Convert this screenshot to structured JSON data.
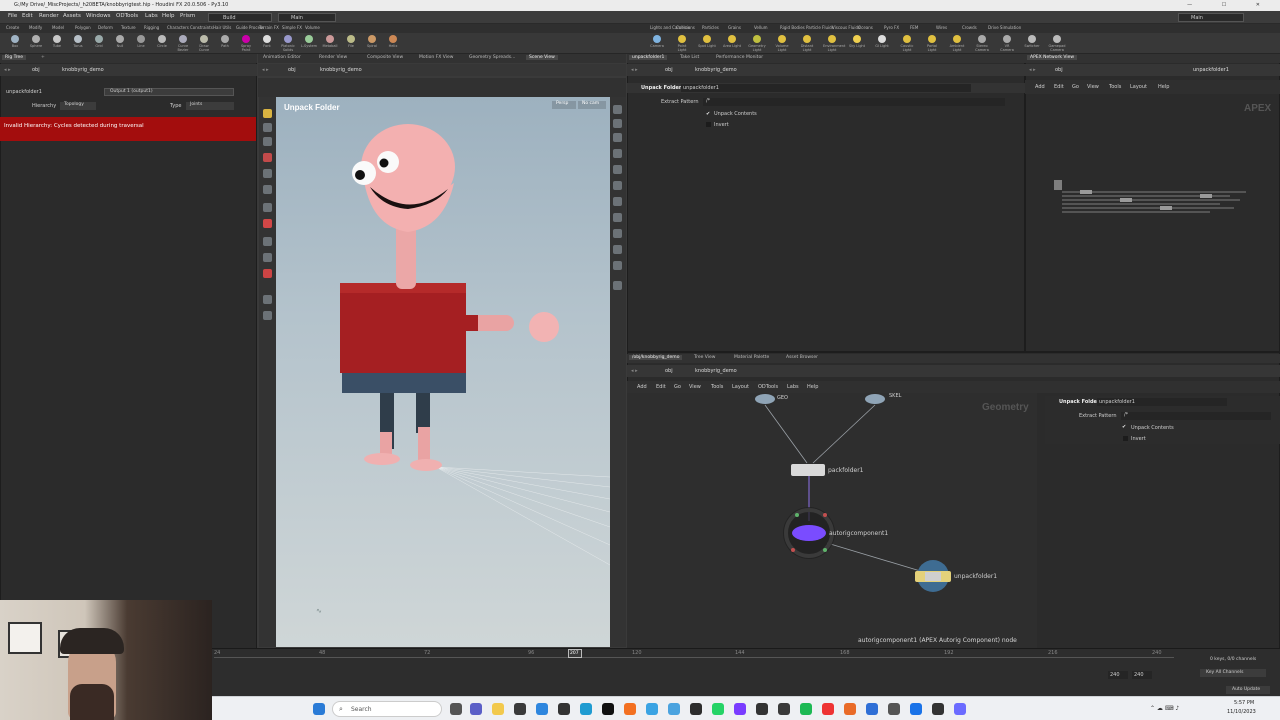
{
  "window": {
    "title": "G:/My Drive/_MiscProjects/_h20BETA/knobbyrigtest.hip - Houdini FX 20.0.506 - Py3.10",
    "controls": [
      "—",
      "☐",
      "✕"
    ]
  },
  "menubar": {
    "items": [
      "File",
      "Edit",
      "Render",
      "Assets",
      "Windows",
      "ODTools",
      "Labs",
      "Help",
      "Prism"
    ],
    "build_label": "Build",
    "desktop_label": "Main",
    "right_desktop_label": "Main"
  },
  "shelf_tabs_left": [
    "Create",
    "Modify",
    "Model",
    "Polygon",
    "Deform",
    "Texture",
    "Rigging",
    "Characters",
    "Constraints",
    "Hair Utils",
    "Guide Process",
    "Terrain FX",
    "Simple FX",
    "Volume"
  ],
  "shelf_tabs_right": [
    "Lights and Cameras",
    "Collisions",
    "Particles",
    "Grains",
    "Vellum",
    "Rigid Bodies",
    "Particle Fluids",
    "Viscous Fluids",
    "Oceans",
    "Pyro FX",
    "FEM",
    "Wires",
    "Crowds",
    "Drive Simulation"
  ],
  "shelf_tools_left": [
    "Box",
    "Sphere",
    "Tube",
    "Torus",
    "Grid",
    "Null",
    "Line",
    "Circle",
    "Curve Bezier",
    "Draw Curve",
    "Path",
    "Spray Paint",
    "Font",
    "Platonic Solids",
    "L-System",
    "Metaball",
    "File",
    "Spiral",
    "Helix"
  ],
  "shelf_tools_right": [
    "Camera",
    "Point Light",
    "Spot Light",
    "Area Light",
    "Geometry Light",
    "Volume Light",
    "Distant Light",
    "Environment Light",
    "Sky Light",
    "GI Light",
    "Caustic Light",
    "Portal Light",
    "Ambient Light",
    "Stereo Camera",
    "VR Camera",
    "Switcher",
    "Gamepad Camera"
  ],
  "rig_tree_panel": {
    "tabs": [
      "Rig Tree"
    ],
    "path": [
      "obj",
      "knobbyrig_demo"
    ],
    "node_label": "unpackfolder1",
    "output_label": "Output 1 (output1)",
    "hierarchy_label": "Hierarchy",
    "hierarchy_value": "Topology",
    "type_label": "Type",
    "type_value": "Joints",
    "error_text": "Invalid Hierarchy: Cycles detected during traversal"
  },
  "viewport_panel": {
    "tabs": [
      "Animation Editor",
      "Render View",
      "Composite View",
      "Motion FX View",
      "Geometry Spreads...",
      "Scene View"
    ],
    "path": [
      "obj",
      "knobbyrig_demo"
    ],
    "title": "Unpack Folder",
    "persp_label": "Persp",
    "cam_label": "No cam"
  },
  "param_panel_top": {
    "tabs": [
      "unpackfolder1",
      "Take List",
      "Performance Monitor"
    ],
    "path": [
      "obj",
      "knobbyrig_demo"
    ],
    "node_type": "Unpack Folder",
    "node_name": "unpackfolder1",
    "extract_label": "Extract Pattern",
    "extract_value": "/*",
    "unpack_contents": "Unpack Contents",
    "invert": "Invert"
  },
  "apex_panel": {
    "tabs": [
      "APEX Network View"
    ],
    "path": [
      "obj"
    ],
    "right_path": "unpackfolder1",
    "menu": [
      "Add",
      "Edit",
      "Go",
      "View",
      "Tools",
      "Layout",
      "Help"
    ],
    "watermark": "APEX"
  },
  "network_panel": {
    "tabs": [
      "/obj/knobbyrig_demo",
      "Tree View",
      "Material Palette",
      "Asset Browser"
    ],
    "path": [
      "obj",
      "knobbyrig_demo"
    ],
    "menu": [
      "Add",
      "Edit",
      "Go",
      "View",
      "Tools",
      "Layout",
      "ODTools",
      "Labs",
      "Help"
    ],
    "watermark": "Geometry",
    "nodes": {
      "geo": "GEO",
      "skel": "SKEL",
      "packfolder": "packfolder1",
      "autorig": "autorigcomponent1",
      "unpack": "unpackfolder1"
    },
    "status": "autorigcomponent1 (APEX Autorig Component) node",
    "inline_params": {
      "node_type": "Unpack Folder",
      "node_name": "unpackfolder1",
      "extract_label": "Extract Pattern",
      "extract_value": "/*",
      "unpack_contents": "Unpack Contents",
      "invert": "Invert"
    }
  },
  "timeline": {
    "ticks": [
      "24",
      "48",
      "72",
      "96",
      "120",
      "144",
      "168",
      "192",
      "216",
      "240"
    ],
    "current_frame": "207",
    "end_a": "240",
    "end_b": "240",
    "keys_label": "0 keys, 0/0 channels",
    "key_all_label": "Key All Channels",
    "auto_update": "Auto Update"
  },
  "taskbar": {
    "search_placeholder": "Search",
    "time": "5:57 PM",
    "date": "11/10/2023"
  },
  "colors": {
    "error": "#a30d0d",
    "accent_purple": "#7a4cff",
    "timeline_marker": "#d8d8d8"
  }
}
